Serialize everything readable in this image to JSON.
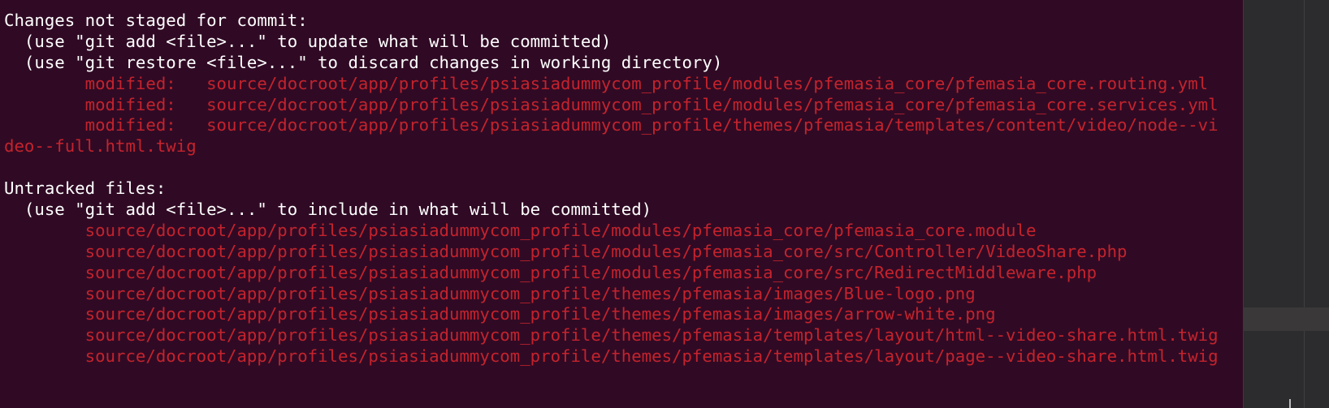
{
  "terminal": {
    "colors": {
      "background": "#300a24",
      "text": "#ffffff",
      "changed": "#c4232d"
    },
    "lines": [
      {
        "text": "Changes not staged for commit:",
        "style": "plain"
      },
      {
        "text": "  (use \"git add <file>...\" to update what will be committed)",
        "style": "plain"
      },
      {
        "text": "  (use \"git restore <file>...\" to discard changes in working directory)",
        "style": "plain"
      },
      {
        "text": "        modified:   source/docroot/app/profiles/psiasiadummycom_profile/modules/pfemasia_core/pfemasia_core.routing.yml",
        "style": "red"
      },
      {
        "text": "        modified:   source/docroot/app/profiles/psiasiadummycom_profile/modules/pfemasia_core/pfemasia_core.services.yml",
        "style": "red"
      },
      {
        "text": "        modified:   source/docroot/app/profiles/psiasiadummycom_profile/themes/pfemasia/templates/content/video/node--vi",
        "style": "red"
      },
      {
        "text": "deo--full.html.twig",
        "style": "red"
      },
      {
        "text": "",
        "style": "plain"
      },
      {
        "text": "Untracked files:",
        "style": "plain"
      },
      {
        "text": "  (use \"git add <file>...\" to include in what will be committed)",
        "style": "plain"
      },
      {
        "text": "        source/docroot/app/profiles/psiasiadummycom_profile/modules/pfemasia_core/pfemasia_core.module",
        "style": "red"
      },
      {
        "text": "        source/docroot/app/profiles/psiasiadummycom_profile/modules/pfemasia_core/src/Controller/VideoShare.php",
        "style": "red"
      },
      {
        "text": "        source/docroot/app/profiles/psiasiadummycom_profile/modules/pfemasia_core/src/RedirectMiddleware.php",
        "style": "red"
      },
      {
        "text": "        source/docroot/app/profiles/psiasiadummycom_profile/themes/pfemasia/images/Blue-logo.png",
        "style": "red"
      },
      {
        "text": "        source/docroot/app/profiles/psiasiadummycom_profile/themes/pfemasia/images/arrow-white.png",
        "style": "red"
      },
      {
        "text": "        source/docroot/app/profiles/psiasiadummycom_profile/themes/pfemasia/templates/layout/html--video-share.html.twig",
        "style": "red"
      },
      {
        "text": "        source/docroot/app/profiles/psiasiadummycom_profile/themes/pfemasia/templates/layout/page--video-share.html.twig",
        "style": "red"
      }
    ]
  }
}
